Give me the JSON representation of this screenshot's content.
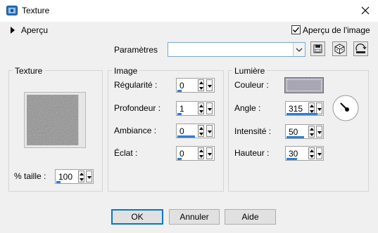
{
  "window": {
    "title": "Texture"
  },
  "apercu": {
    "label": "Aperçu"
  },
  "preview_image": {
    "label": "Aperçu de l'image",
    "checked": true
  },
  "presets": {
    "label": "Paramètres",
    "value": ""
  },
  "texture_group": {
    "title": "Texture",
    "size_label": "% taille :",
    "size_value": "100",
    "size_fill": 0.2
  },
  "image_group": {
    "title": "Image",
    "fields": [
      {
        "label": "Régularité :",
        "value": "0",
        "fill": 0.0
      },
      {
        "label": "Profondeur :",
        "value": "1",
        "fill": 0.0
      },
      {
        "label": "Ambiance :",
        "value": "0",
        "fill": 0.5
      },
      {
        "label": "Éclat :",
        "value": "0",
        "fill": 0.0
      }
    ]
  },
  "light_group": {
    "title": "Lumière",
    "color_label": "Couleur :",
    "color": "#a8a5b4",
    "fields": [
      {
        "label": "Angle :",
        "value": "315",
        "fill": 0.87
      },
      {
        "label": "Intensité :",
        "value": "50",
        "fill": 0.5
      },
      {
        "label": "Hauteur :",
        "value": "30",
        "fill": 0.3
      }
    ]
  },
  "buttons": {
    "ok": "OK",
    "cancel": "Annuler",
    "help": "Aide"
  },
  "icons": [
    "texture-app-icon",
    "close-icon",
    "expand-arrow-icon",
    "checkbox-icon",
    "save-preset-icon",
    "random-icon",
    "reset-icon",
    "angle-dial-icon"
  ]
}
